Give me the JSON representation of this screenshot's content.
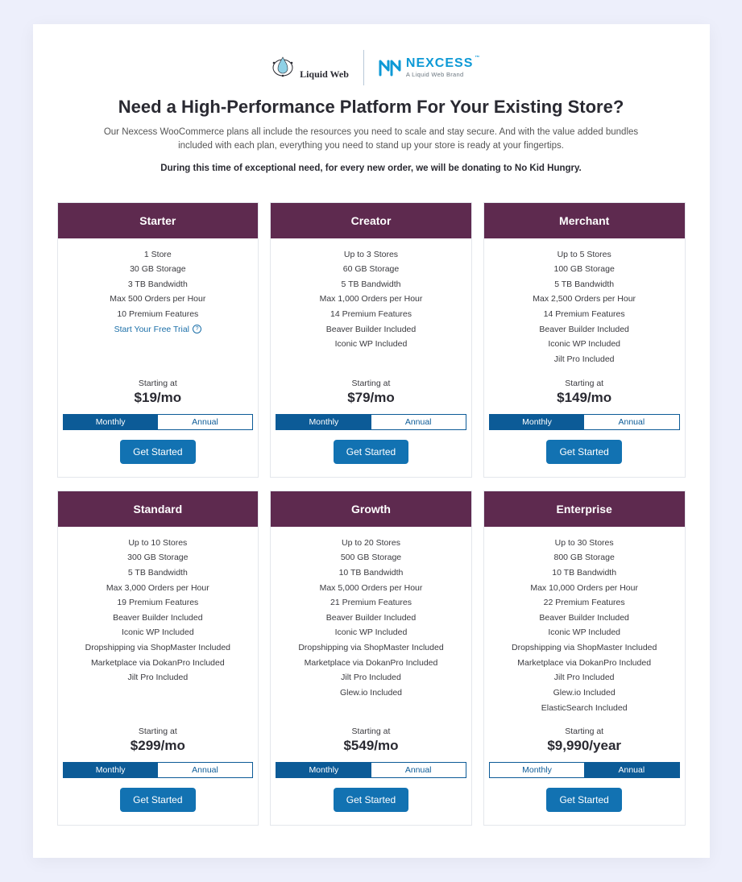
{
  "logos": {
    "liquidweb": "Liquid Web",
    "nexcess_top": "NEXCESS",
    "nexcess_sub": "A Liquid Web Brand"
  },
  "headline": "Need a High-Performance Platform For Your Existing Store?",
  "subtext": "Our Nexcess WooCommerce plans all include the resources you need to scale and stay secure. And with the value added bundles included with each plan, everything you need to stand up your store is ready at your fingertips.",
  "donation": "During this time of exceptional need, for every new order, we will be donating to No Kid Hungry.",
  "labels": {
    "starting_at": "Starting at",
    "monthly": "Monthly",
    "annual": "Annual",
    "get_started": "Get Started",
    "trial": "Start Your Free Trial"
  },
  "plans": [
    {
      "name": "Starter",
      "price": "$19/mo",
      "active": "monthly",
      "trial": true,
      "features": [
        "1 Store",
        "30 GB Storage",
        "3 TB Bandwidth",
        "Max 500 Orders per Hour",
        "10 Premium Features"
      ]
    },
    {
      "name": "Creator",
      "price": "$79/mo",
      "active": "monthly",
      "features": [
        "Up to 3 Stores",
        "60 GB Storage",
        "5 TB Bandwidth",
        "Max 1,000 Orders per Hour",
        "14 Premium Features",
        "Beaver Builder Included",
        "Iconic WP Included"
      ]
    },
    {
      "name": "Merchant",
      "price": "$149/mo",
      "active": "monthly",
      "features": [
        "Up to 5 Stores",
        "100 GB Storage",
        "5 TB Bandwidth",
        "Max 2,500 Orders per Hour",
        "14 Premium Features",
        "Beaver Builder Included",
        "Iconic WP Included",
        "Jilt Pro Included"
      ]
    },
    {
      "name": "Standard",
      "price": "$299/mo",
      "active": "monthly",
      "features": [
        "Up to 10 Stores",
        "300 GB Storage",
        "5 TB Bandwidth",
        "Max 3,000 Orders per Hour",
        "19 Premium Features",
        "Beaver Builder Included",
        "Iconic WP Included",
        "Dropshipping via ShopMaster Included",
        "Marketplace via DokanPro Included",
        "Jilt Pro Included"
      ]
    },
    {
      "name": "Growth",
      "price": "$549/mo",
      "active": "monthly",
      "features": [
        "Up to 20 Stores",
        "500 GB Storage",
        "10 TB Bandwidth",
        "Max 5,000 Orders per Hour",
        "21 Premium Features",
        "Beaver Builder Included",
        "Iconic WP Included",
        "Dropshipping via ShopMaster Included",
        "Marketplace via DokanPro Included",
        "Jilt Pro Included",
        "Glew.io Included"
      ]
    },
    {
      "name": "Enterprise",
      "price": "$9,990/year",
      "active": "annual",
      "features": [
        "Up to 30 Stores",
        "800 GB Storage",
        "10 TB Bandwidth",
        "Max 10,000 Orders per Hour",
        "22 Premium Features",
        "Beaver Builder Included",
        "Iconic WP Included",
        "Dropshipping via ShopMaster Included",
        "Marketplace via DokanPro Included",
        "Jilt Pro Included",
        "Glew.io Included",
        "ElasticSearch Included"
      ]
    }
  ]
}
